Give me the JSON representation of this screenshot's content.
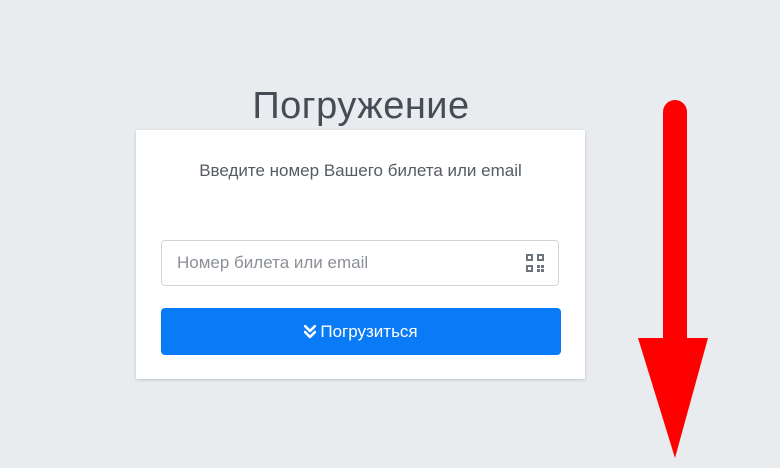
{
  "page": {
    "title": "Погружение"
  },
  "card": {
    "prompt": "Введите номер Вашего билета или email",
    "input": {
      "value": "",
      "placeholder": "Номер билета или email"
    },
    "submit_label": "Погрузиться"
  },
  "colors": {
    "background": "#e9ecef",
    "button": "#0a7bf7",
    "arrow": "#ff0000"
  },
  "icons": {
    "input_icon": "qr-code-icon",
    "button_icon": "double-chevron-down-icon",
    "annotation": "red-arrow-down-icon"
  }
}
